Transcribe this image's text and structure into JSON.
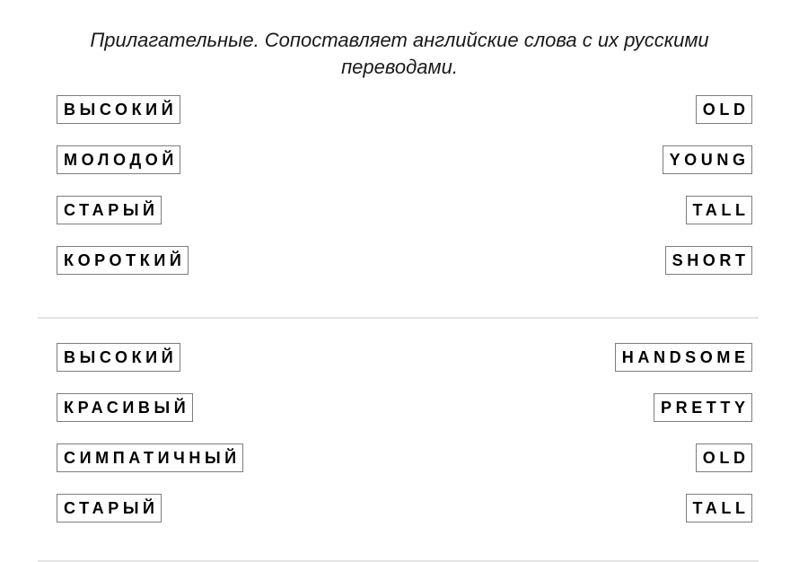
{
  "page": {
    "title_line_1": "Прилагательные. Сопоставляет английские слова с их",
    "title_line_2": "русскими переводами.",
    "title_full": "Прилагательные. Сопоставляет английские слова с их русскими переводами.",
    "background_color": "#ffffff",
    "text_color": "#000000",
    "box_border_color": "#7d7d7d",
    "separator_color": "#e3e3e3"
  },
  "exercise": {
    "type": "matching",
    "groups": [
      {
        "id": "group-1",
        "rows": [
          {
            "left": "ВЫСОКИЙ",
            "right": "OLD"
          },
          {
            "left": "МОЛОДОЙ",
            "right": "YOUNG"
          },
          {
            "left": "СТАРЫЙ",
            "right": "TALL"
          },
          {
            "left": "КОРОТКИЙ",
            "right": "SHORT"
          }
        ]
      },
      {
        "id": "group-2",
        "rows": [
          {
            "left": "ВЫСОКИЙ",
            "right": "HANDSOME"
          },
          {
            "left": "КРАСИВЫЙ",
            "right": "PRETTY"
          },
          {
            "left": "СИМПАТИЧНЫЙ",
            "right": "OLD"
          },
          {
            "left": "СТАРЫЙ",
            "right": "TALL"
          }
        ]
      }
    ]
  }
}
